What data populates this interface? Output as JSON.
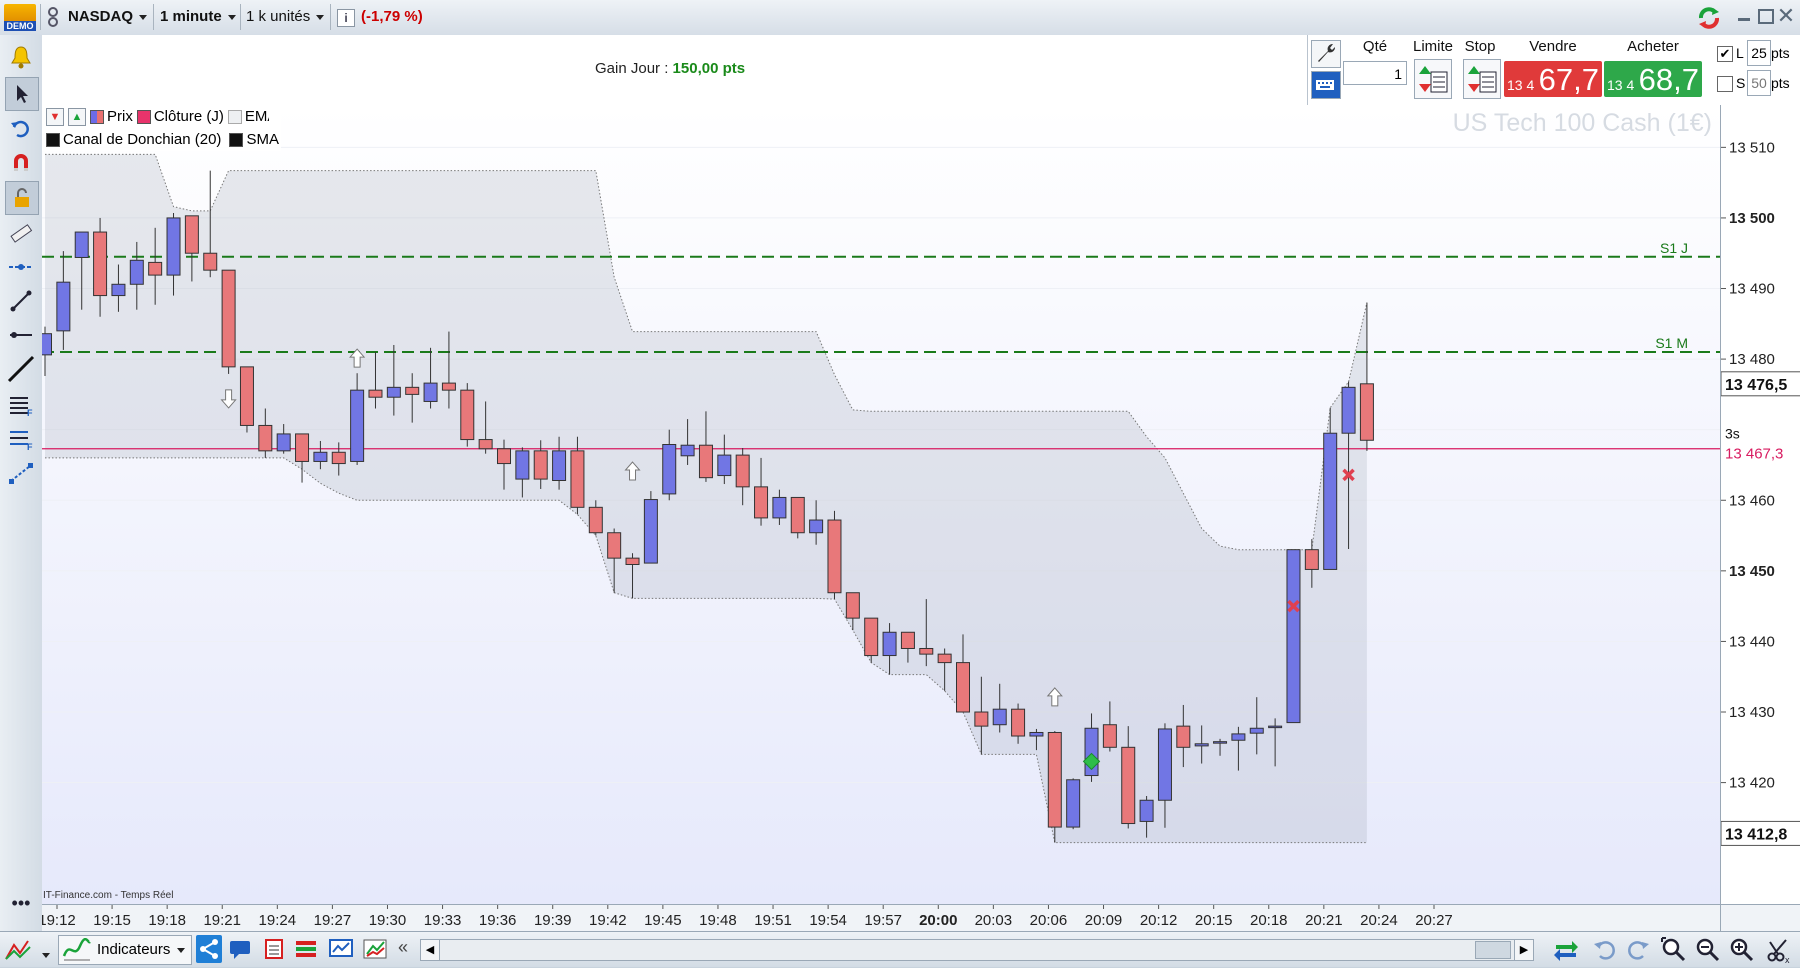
{
  "toolbar": {
    "demo_label": "DEMO",
    "instrument": "NASDAQ",
    "timeframe": "1 minute",
    "units": "1 k unités",
    "info_icon": "info-icon",
    "change": "(-1,79 %)",
    "change_color": "#cc0000"
  },
  "gain": {
    "label": "Gain Jour :",
    "value": "150,00 pts",
    "value_color": "#1a8a1a"
  },
  "order": {
    "qty_label": "Qté",
    "qty_value": "1",
    "limit_label": "Limite",
    "stop_label": "Stop",
    "sell_label": "Vendre",
    "buy_label": "Acheter",
    "sell_prefix": "13 4",
    "sell_price": "67,7",
    "buy_prefix": "13 4",
    "buy_price": "68,7",
    "sell_color": "#e03a3a",
    "buy_color": "#2ea84a",
    "l_label": "L",
    "l_value": "25",
    "l_unit": "pts",
    "s_label": "S",
    "s_value": "50",
    "s_unit": "pts",
    "l_checked": true,
    "s_checked": false
  },
  "legend": {
    "prix": "Prix",
    "cloture": "Clôture (J)",
    "ema": "EMA",
    "donchian": "Canal de Donchian (20)",
    "sma": "SMA"
  },
  "watermark": "US Tech 100 Cash (1€)",
  "source": "IT-Finance.com - Temps Réel",
  "price_tags": {
    "current": "13 476,5",
    "bottom": "13 412,8",
    "countdown": "3s",
    "hline": "13 467,3",
    "hline_color": "#d81b60"
  },
  "levels": {
    "s1j": "S1 J",
    "s1m": "S1 M"
  },
  "bottom": {
    "indicators_label": "Indicateurs"
  },
  "chart_data": {
    "type": "candlestick",
    "title": "US Tech 100 Cash (1€)",
    "ylim": [
      13402.8,
      13516.0
    ],
    "y_ticks": [
      13420,
      13430,
      13440,
      13450,
      13460,
      13470,
      13480,
      13490,
      13500,
      13510
    ],
    "y_tick_labels": [
      "13 420",
      "13 430",
      "13 440",
      "13 450",
      "13 460",
      "13 470",
      "13 480",
      "13 490",
      "13 500",
      "13 510"
    ],
    "y_bold_ticks": [
      13450,
      13500
    ],
    "x_ticks": [
      "19:12",
      "19:15",
      "19:18",
      "19:21",
      "19:24",
      "19:27",
      "19:30",
      "19:33",
      "19:36",
      "19:39",
      "19:42",
      "19:45",
      "19:48",
      "19:51",
      "19:54",
      "19:57",
      "20:00",
      "20:03",
      "20:06",
      "20:09",
      "20:12",
      "20:15",
      "20:18",
      "20:21",
      "20:24",
      "20:27"
    ],
    "x_bold_tick": "20:00",
    "first_minute": "19:12",
    "horizontal_levels": [
      {
        "name": "S1 J",
        "value": 13494.5,
        "color": "#1a7a1a"
      },
      {
        "name": "S1 M",
        "value": 13481.0,
        "color": "#1a7a1a"
      },
      {
        "name": "13 467,3",
        "value": 13467.3,
        "color": "#d81b60"
      }
    ],
    "candles": [
      {
        "o": 13480.6,
        "h": 13484.6,
        "l": 13477.6,
        "c": 13483.6
      },
      {
        "o": 13484.0,
        "h": 13495.3,
        "l": 13481.3,
        "c": 13490.9
      },
      {
        "o": 13494.4,
        "h": 13498.0,
        "l": 13487.0,
        "c": 13498.0
      },
      {
        "o": 13498.0,
        "h": 13500.0,
        "l": 13486.0,
        "c": 13489.0
      },
      {
        "o": 13489.0,
        "h": 13493.4,
        "l": 13486.7,
        "c": 13490.6
      },
      {
        "o": 13490.6,
        "h": 13496.6,
        "l": 13487.0,
        "c": 13494.0
      },
      {
        "o": 13493.7,
        "h": 13498.6,
        "l": 13487.7,
        "c": 13491.9
      },
      {
        "o": 13491.9,
        "h": 13500.7,
        "l": 13489.0,
        "c": 13500.0
      },
      {
        "o": 13500.3,
        "h": 13500.3,
        "l": 13491.0,
        "c": 13495.0
      },
      {
        "o": 13495.0,
        "h": 13506.7,
        "l": 13491.6,
        "c": 13492.6
      },
      {
        "o": 13492.6,
        "h": 13492.6,
        "l": 13477.9,
        "c": 13478.9
      },
      {
        "o": 13478.9,
        "h": 13478.9,
        "l": 13469.6,
        "c": 13470.6
      },
      {
        "o": 13470.6,
        "h": 13473.0,
        "l": 13466.0,
        "c": 13467.0
      },
      {
        "o": 13467.0,
        "h": 13470.8,
        "l": 13466.6,
        "c": 13469.4
      },
      {
        "o": 13469.4,
        "h": 13469.4,
        "l": 13462.5,
        "c": 13465.5
      },
      {
        "o": 13465.5,
        "h": 13468.4,
        "l": 13464.4,
        "c": 13466.8
      },
      {
        "o": 13466.8,
        "h": 13468.2,
        "l": 13463.5,
        "c": 13465.2
      },
      {
        "o": 13465.5,
        "h": 13478.0,
        "l": 13465.0,
        "c": 13475.6
      },
      {
        "o": 13475.6,
        "h": 13481.0,
        "l": 13473.0,
        "c": 13474.6
      },
      {
        "o": 13474.6,
        "h": 13482.0,
        "l": 13472.0,
        "c": 13476.0
      },
      {
        "o": 13476.0,
        "h": 13478.0,
        "l": 13471.0,
        "c": 13475.0
      },
      {
        "o": 13474.0,
        "h": 13481.6,
        "l": 13473.0,
        "c": 13476.6
      },
      {
        "o": 13476.6,
        "h": 13483.9,
        "l": 13473.0,
        "c": 13475.6
      },
      {
        "o": 13475.6,
        "h": 13476.6,
        "l": 13467.6,
        "c": 13468.6
      },
      {
        "o": 13468.6,
        "h": 13474.0,
        "l": 13466.6,
        "c": 13467.3
      },
      {
        "o": 13467.3,
        "h": 13468.6,
        "l": 13461.5,
        "c": 13465.2
      },
      {
        "o": 13463.0,
        "h": 13467.5,
        "l": 13460.4,
        "c": 13467.0
      },
      {
        "o": 13467.0,
        "h": 13468.5,
        "l": 13461.6,
        "c": 13463.0
      },
      {
        "o": 13462.8,
        "h": 13469.0,
        "l": 13461.5,
        "c": 13467.0
      },
      {
        "o": 13467.0,
        "h": 13469.0,
        "l": 13458.0,
        "c": 13459.0
      },
      {
        "o": 13459.0,
        "h": 13460.0,
        "l": 13455.0,
        "c": 13455.4
      },
      {
        "o": 13455.4,
        "h": 13456.0,
        "l": 13446.9,
        "c": 13451.8
      },
      {
        "o": 13451.8,
        "h": 13452.5,
        "l": 13446.1,
        "c": 13450.9
      },
      {
        "o": 13451.1,
        "h": 13461.3,
        "l": 13451.1,
        "c": 13460.1
      },
      {
        "o": 13460.9,
        "h": 13470.0,
        "l": 13460.0,
        "c": 13467.9
      },
      {
        "o": 13466.3,
        "h": 13471.5,
        "l": 13465.0,
        "c": 13467.8
      },
      {
        "o": 13467.8,
        "h": 13472.6,
        "l": 13462.6,
        "c": 13463.2
      },
      {
        "o": 13463.5,
        "h": 13469.3,
        "l": 13462.3,
        "c": 13466.4
      },
      {
        "o": 13466.4,
        "h": 13467.4,
        "l": 13459.3,
        "c": 13461.9
      },
      {
        "o": 13461.9,
        "h": 13466.0,
        "l": 13456.4,
        "c": 13457.5
      },
      {
        "o": 13457.5,
        "h": 13461.5,
        "l": 13456.5,
        "c": 13460.4
      },
      {
        "o": 13460.4,
        "h": 13460.4,
        "l": 13454.6,
        "c": 13455.4
      },
      {
        "o": 13455.4,
        "h": 13460.0,
        "l": 13453.7,
        "c": 13457.2
      },
      {
        "o": 13457.2,
        "h": 13458.5,
        "l": 13446.0,
        "c": 13446.9
      },
      {
        "o": 13446.9,
        "h": 13446.9,
        "l": 13441.6,
        "c": 13443.3
      },
      {
        "o": 13443.3,
        "h": 13443.3,
        "l": 13437.0,
        "c": 13438.0
      },
      {
        "o": 13438.0,
        "h": 13442.6,
        "l": 13435.3,
        "c": 13441.3
      },
      {
        "o": 13441.3,
        "h": 13441.3,
        "l": 13437.0,
        "c": 13439.0
      },
      {
        "o": 13439.0,
        "h": 13446.0,
        "l": 13436.5,
        "c": 13438.2
      },
      {
        "o": 13438.2,
        "h": 13439.0,
        "l": 13433.0,
        "c": 13437.0
      },
      {
        "o": 13437.0,
        "h": 13441.0,
        "l": 13430.0,
        "c": 13430.0
      },
      {
        "o": 13430.0,
        "h": 13435.0,
        "l": 13424.0,
        "c": 13428.0
      },
      {
        "o": 13428.2,
        "h": 13434.0,
        "l": 13427.1,
        "c": 13430.4
      },
      {
        "o": 13430.4,
        "h": 13431.2,
        "l": 13425.5,
        "c": 13426.6
      },
      {
        "o": 13426.6,
        "h": 13427.6,
        "l": 13424.6,
        "c": 13427.1
      },
      {
        "o": 13427.1,
        "h": 13427.3,
        "l": 13411.5,
        "c": 13413.7
      },
      {
        "o": 13413.7,
        "h": 13420.6,
        "l": 13413.4,
        "c": 13420.4
      },
      {
        "o": 13421.0,
        "h": 13429.8,
        "l": 13420.1,
        "c": 13427.7
      },
      {
        "o": 13428.2,
        "h": 13431.5,
        "l": 13424.4,
        "c": 13425.0
      },
      {
        "o": 13425.0,
        "h": 13428.0,
        "l": 13413.5,
        "c": 13414.2
      },
      {
        "o": 13414.5,
        "h": 13418.1,
        "l": 13412.2,
        "c": 13417.5
      },
      {
        "o": 13417.5,
        "h": 13428.4,
        "l": 13413.6,
        "c": 13427.6
      },
      {
        "o": 13428.0,
        "h": 13431.0,
        "l": 13422.2,
        "c": 13425.0
      },
      {
        "o": 13425.2,
        "h": 13428.1,
        "l": 13422.7,
        "c": 13425.5
      },
      {
        "o": 13425.8,
        "h": 13426.2,
        "l": 13423.8,
        "c": 13425.8
      },
      {
        "o": 13426.0,
        "h": 13427.9,
        "l": 13421.7,
        "c": 13426.9
      },
      {
        "o": 13427.0,
        "h": 13432.1,
        "l": 13424.0,
        "c": 13427.7
      },
      {
        "o": 13427.9,
        "h": 13429.1,
        "l": 13422.3,
        "c": 13428.0
      },
      {
        "o": 13428.5,
        "h": 13453.0,
        "l": 13428.5,
        "c": 13453.0
      },
      {
        "o": 13453.0,
        "h": 13454.5,
        "l": 13447.6,
        "c": 13450.2
      },
      {
        "o": 13450.2,
        "h": 13473.1,
        "l": 13450.2,
        "c": 13469.5
      },
      {
        "o": 13469.5,
        "h": 13476.8,
        "l": 13453.1,
        "c": 13476.0
      },
      {
        "o": 13476.5,
        "h": 13488.0,
        "l": 13467.0,
        "c": 13468.5
      }
    ],
    "donchian_upper": [
      13509,
      13509,
      13509,
      13509,
      13509,
      13509,
      13509,
      13501.6,
      13501,
      13501,
      13506.7,
      13506.7,
      13506.7,
      13506.7,
      13506.7,
      13506.7,
      13506.7,
      13506.7,
      13506.7,
      13506.7,
      13506.7,
      13506.7,
      13506.7,
      13506.7,
      13506.7,
      13506.7,
      13506.7,
      13506.7,
      13506.7,
      13506.7,
      13506.7,
      13491.6,
      13483.9,
      13483.9,
      13483.9,
      13483.9,
      13483.9,
      13483.9,
      13483.9,
      13483.9,
      13483.9,
      13483.9,
      13483.9,
      13477.8,
      13472.8,
      13472.6,
      13472.6,
      13472.6,
      13472.6,
      13472.6,
      13472.6,
      13472.6,
      13472.6,
      13472.6,
      13472.6,
      13472.6,
      13472.6,
      13472.6,
      13472.6,
      13472.6,
      13469.0,
      13466.0,
      13461.0,
      13456.0,
      13453.5,
      13453.0,
      13453.0,
      13453.0,
      13453.0,
      13453.0,
      13473.1,
      13476.8,
      13488.0
    ],
    "donchian_lower": [
      13466,
      13466,
      13466,
      13466,
      13466,
      13466,
      13466,
      13466,
      13466,
      13466,
      13466,
      13466,
      13466,
      13466,
      13464.4,
      13462.4,
      13461.0,
      13460.0,
      13460.0,
      13460.0,
      13460.0,
      13460.0,
      13460.0,
      13460.0,
      13460.0,
      13460.0,
      13460.0,
      13460.0,
      13460.0,
      13458.0,
      13455.0,
      13446.9,
      13446.1,
      13446.1,
      13446.1,
      13446.1,
      13446.1,
      13446.1,
      13446.1,
      13446.1,
      13446.1,
      13446.1,
      13446.1,
      13446.0,
      13441.6,
      13437.0,
      13435.3,
      13435.3,
      13435.3,
      13433.0,
      13430.0,
      13424.0,
      13424.0,
      13424.0,
      13424.0,
      13411.5,
      13411.5,
      13411.5,
      13411.5,
      13411.5,
      13411.5,
      13411.5,
      13411.5,
      13411.5,
      13411.5,
      13411.5,
      13411.5,
      13411.5,
      13411.5,
      13411.5,
      13411.5,
      13411.5,
      13411.5
    ]
  }
}
